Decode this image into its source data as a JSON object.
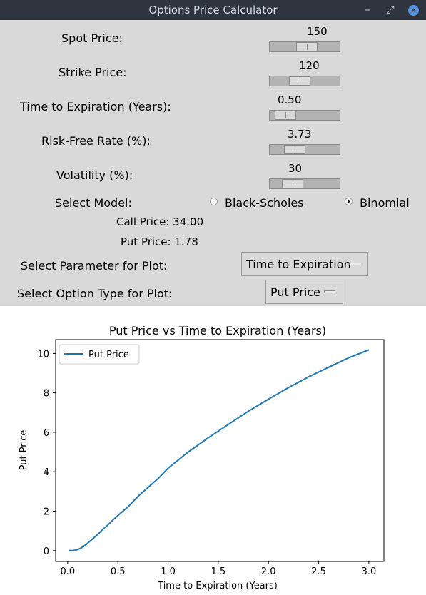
{
  "window": {
    "title": "Options Price Calculator"
  },
  "params": [
    {
      "label": "Spot Price:",
      "value": "150",
      "level": 0.55
    },
    {
      "label": "Strike Price:",
      "value": "120",
      "level": 0.4
    },
    {
      "label": "Time to Expiration (Years):",
      "value": "0.50",
      "level": 0.1
    },
    {
      "label": "Risk-Free Rate (%):",
      "value": "3.73",
      "level": 0.3
    },
    {
      "label": "Volatility (%):",
      "value": "30",
      "level": 0.25
    }
  ],
  "model": {
    "label": "Select Model:",
    "options": [
      "Black-Scholes",
      "Binomial"
    ],
    "selected": "Binomial"
  },
  "results": {
    "call": "Call Price: 34.00",
    "put": "Put Price: 1.78"
  },
  "plot_param": {
    "label": "Select Parameter for Plot:",
    "value": "Time to Expiration"
  },
  "option_type": {
    "label": "Select Option Type for Plot:",
    "value": "Put Price"
  },
  "chart_data": {
    "type": "line",
    "title": "Put Price vs Time to Expiration (Years)",
    "xlabel": "Time to Expiration (Years)",
    "ylabel": "Put Price",
    "xlim": [
      -0.12,
      3.15
    ],
    "ylim": [
      -0.55,
      10.7
    ],
    "xticks": [
      0.0,
      0.5,
      1.0,
      1.5,
      2.0,
      2.5,
      3.0
    ],
    "xtick_labels": [
      "0.0",
      "0.5",
      "1.0",
      "1.5",
      "2.0",
      "2.5",
      "3.0"
    ],
    "yticks": [
      0,
      2,
      4,
      6,
      8,
      10
    ],
    "ytick_labels": [
      "0",
      "2",
      "4",
      "6",
      "8",
      "10"
    ],
    "legend": {
      "entries": [
        "Put Price"
      ],
      "position": "upper left"
    },
    "grid": false,
    "series": [
      {
        "name": "Put Price",
        "color": "#1f77b4",
        "x": [
          0.01,
          0.05,
          0.1,
          0.15,
          0.2,
          0.25,
          0.3,
          0.35,
          0.4,
          0.45,
          0.5,
          0.6,
          0.7,
          0.8,
          0.9,
          1.0,
          1.2,
          1.4,
          1.6,
          1.8,
          2.0,
          2.2,
          2.4,
          2.6,
          2.8,
          3.0
        ],
        "y": [
          0.0,
          0.0,
          0.05,
          0.18,
          0.38,
          0.6,
          0.83,
          1.08,
          1.3,
          1.55,
          1.78,
          2.22,
          2.75,
          3.2,
          3.65,
          4.18,
          5.0,
          5.72,
          6.4,
          7.07,
          7.68,
          8.27,
          8.81,
          9.3,
          9.78,
          10.18
        ]
      }
    ]
  }
}
